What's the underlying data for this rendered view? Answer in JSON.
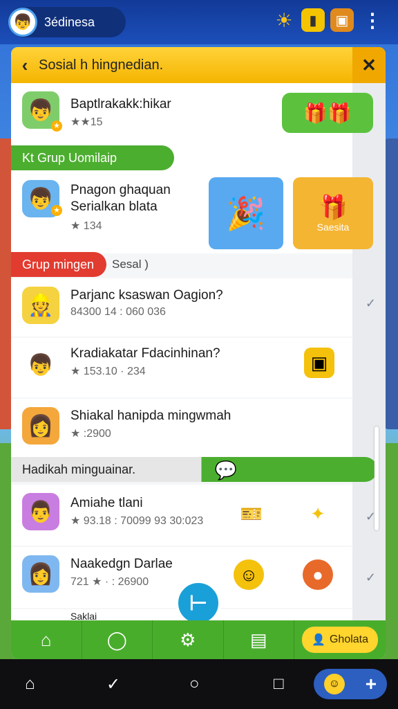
{
  "topbar": {
    "profile_name": "3édinesa",
    "icons": [
      "sun-icon",
      "note-icon",
      "gift-box-icon",
      "more-icon"
    ]
  },
  "panel": {
    "title": "Sosial h hingnedian.",
    "featured": {
      "title": "Baptlrakakk:hikar",
      "sub": "★★15"
    },
    "section1": "Kt Grup Uomilaip",
    "group_card": {
      "title": "Pnagon ghaquan",
      "title2": "Serialkan blata",
      "sub": "★ 134",
      "promo_label": "Saesita"
    },
    "section2": "Grup mingen",
    "section2_tag": "Sesal )",
    "rows": [
      {
        "title": "Parjanc ksaswan Oagion?",
        "sub": "84300 14 : 060 036"
      },
      {
        "title": "Kradiakatar Fdacinhinan?",
        "sub": "★ 153.10 · 234"
      },
      {
        "title": "Shiakal hanipda mingwmah",
        "sub": "★ :2900"
      }
    ],
    "section3": "Hadikah minguainar.",
    "rows2": [
      {
        "title": "Amiahe tlani",
        "sub": "★ 93.18 : 70099 93 30:023"
      },
      {
        "title": "Naakedgn Darlae",
        "sub": "721 ★ · : 26900"
      }
    ],
    "partial_row": "Saklai"
  },
  "tabbar": {
    "cta_label": "Gholata"
  },
  "fab_label": "⊢"
}
